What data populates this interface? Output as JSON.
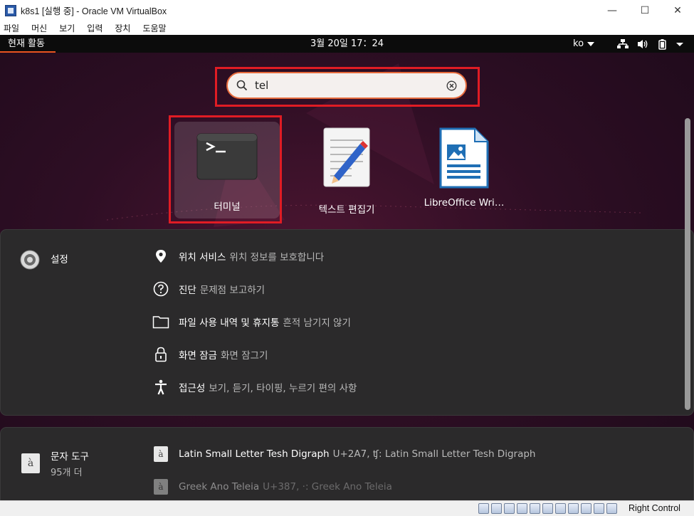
{
  "window": {
    "title": "k8s1 [실행 중] - Oracle VM VirtualBox",
    "controls": {
      "minimize": "—",
      "maximize": "☐",
      "close": "✕"
    }
  },
  "menubar": {
    "items": [
      "파일",
      "머신",
      "보기",
      "입력",
      "장치",
      "도움말"
    ]
  },
  "topbar": {
    "activities": "현재 활동",
    "clock": "3월 20일  17：24",
    "language": "ko",
    "tray_icons": [
      "network-icon",
      "volume-icon",
      "battery-icon",
      "system-menu-caret-icon"
    ]
  },
  "search": {
    "value": "tel",
    "icon": "search-icon",
    "clear_icon": "clear-icon"
  },
  "apps": [
    {
      "label": "터미널",
      "icon": "terminal-icon",
      "selected": true
    },
    {
      "label": "텍스트 편집기",
      "icon": "text-editor-icon",
      "selected": false
    },
    {
      "label": "LibreOffice Wri…",
      "icon": "libreoffice-writer-icon",
      "selected": false
    }
  ],
  "settings_provider": {
    "name": "설정",
    "icon": "settings-gear-icon",
    "results": [
      {
        "title": "위치 서비스",
        "desc": "위치 정보를 보호합니다",
        "icon": "location-pin-icon"
      },
      {
        "title": "진단",
        "desc": "문제점 보고하기",
        "icon": "help-circle-icon"
      },
      {
        "title": "파일 사용 내역 및 휴지통",
        "desc": "흔적 남기지 않기",
        "icon": "folder-icon"
      },
      {
        "title": "화면 잠금",
        "desc": "화면 잠그기",
        "icon": "lock-icon"
      },
      {
        "title": "접근성",
        "desc": "보기, 듣기, 타이핑, 누르기 편의 사항",
        "icon": "accessibility-icon"
      }
    ]
  },
  "characters_provider": {
    "name": "문자 도구",
    "count": "95개 더",
    "icon": "characters-app-icon",
    "glyph": "à",
    "results": [
      {
        "title": "Latin Small Letter Tesh Digraph",
        "desc": "U+2A7, ʧ: Latin Small Letter Tesh Digraph"
      },
      {
        "title": "Greek Ano Teleia",
        "desc": "U+387, ·: Greek Ano Teleia"
      }
    ]
  },
  "statusbar": {
    "host_key": "Right Control"
  },
  "colors": {
    "highlight": "#e01c24",
    "accent": "#e95420"
  }
}
